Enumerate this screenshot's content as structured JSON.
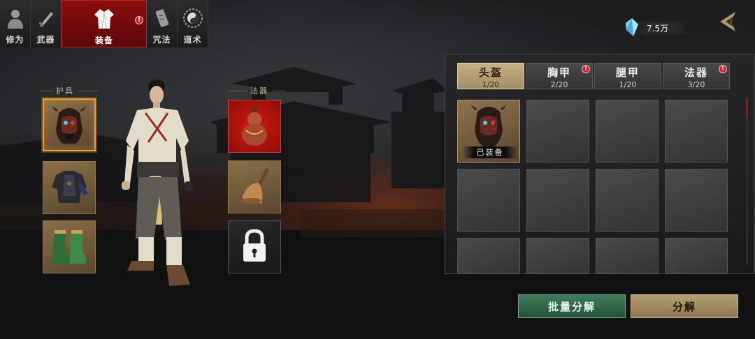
{
  "tabs": [
    {
      "label": "修为",
      "icon": "bust-icon",
      "active": false
    },
    {
      "label": "武器",
      "icon": "sword-icon",
      "active": false
    },
    {
      "label": "装备",
      "icon": "robe-icon",
      "active": true,
      "badge": "!"
    },
    {
      "label": "咒法",
      "icon": "scroll-talisman-icon",
      "active": false
    },
    {
      "label": "道术",
      "icon": "taiji-icon",
      "active": false
    }
  ],
  "currency": {
    "value": "7.5万",
    "icon": "crystal-icon"
  },
  "back": {
    "icon": "back-arrow-icon"
  },
  "equipment": {
    "protect_label": "护具",
    "artifact_label": "法器",
    "protect_slots": [
      {
        "item": "demon-mask-helmet-icon",
        "selected": true
      },
      {
        "item": "armor-chestplate-icon",
        "selected": false
      },
      {
        "item": "green-boots-icon",
        "selected": false
      }
    ],
    "artifact_slots": [
      {
        "item": "gourd-icon",
        "style": "red"
      },
      {
        "item": "bell-icon",
        "style": "normal"
      },
      {
        "item": "padlock-icon",
        "style": "locked"
      }
    ]
  },
  "inventory": {
    "tabs": [
      {
        "label": "头盔",
        "count": "1/20",
        "active": true,
        "badge": false
      },
      {
        "label": "胸甲",
        "count": "2/20",
        "active": false,
        "badge": true
      },
      {
        "label": "腿甲",
        "count": "1/20",
        "active": false,
        "badge": false
      },
      {
        "label": "法器",
        "count": "3/20",
        "active": false,
        "badge": true
      }
    ],
    "badge_text": "!",
    "first_item": {
      "icon": "demon-mask-helmet-icon",
      "status": "已装备"
    }
  },
  "buttons": {
    "batch_decompose": "批量分解",
    "decompose": "分解"
  },
  "colors": {
    "accent_red": "#8a0c0e",
    "gold_select": "#f0a02c",
    "green_button": "#3f7b5a",
    "tan_button": "#b69e73"
  }
}
